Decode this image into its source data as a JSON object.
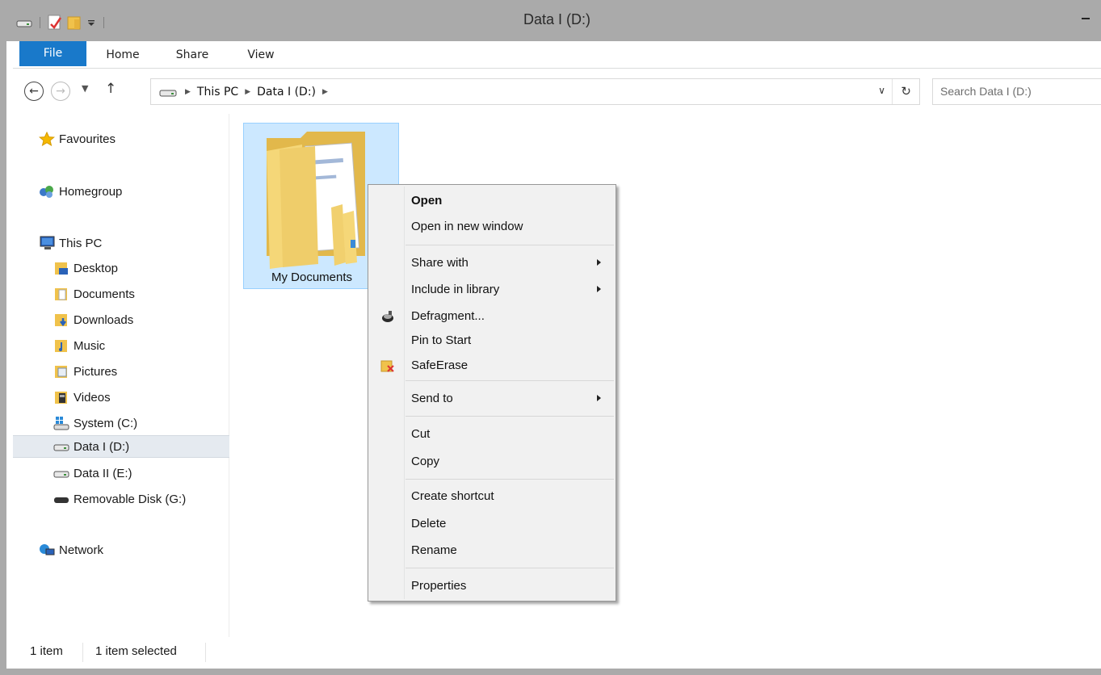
{
  "window": {
    "title": "Data I (D:)"
  },
  "ribbon": {
    "tabs": [
      "File",
      "Home",
      "Share",
      "View"
    ]
  },
  "address": {
    "crumbs": [
      "This PC",
      "Data I (D:)"
    ],
    "search_placeholder": "Search Data I (D:)"
  },
  "sidebar": {
    "favourites": "Favourites",
    "homegroup": "Homegroup",
    "this_pc": "This PC",
    "items": [
      "Desktop",
      "Documents",
      "Downloads",
      "Music",
      "Pictures",
      "Videos",
      "System (C:)",
      "Data I (D:)",
      "Data II (E:)",
      "Removable Disk (G:)"
    ],
    "network": "Network"
  },
  "content": {
    "folder_label": "My Documents"
  },
  "context_menu": {
    "items": [
      "Open",
      "Open in new window",
      "Share with",
      "Include in library",
      "Defragment...",
      "Pin to Start",
      "SafeErase",
      "Send to",
      "Cut",
      "Copy",
      "Create shortcut",
      "Delete",
      "Rename",
      "Properties"
    ]
  },
  "status": {
    "count": "1 item",
    "selected": "1 item selected"
  },
  "colors": {
    "file_tab": "#1979ca",
    "selection": "#cce8ff",
    "selection_border": "#99d1ff"
  }
}
